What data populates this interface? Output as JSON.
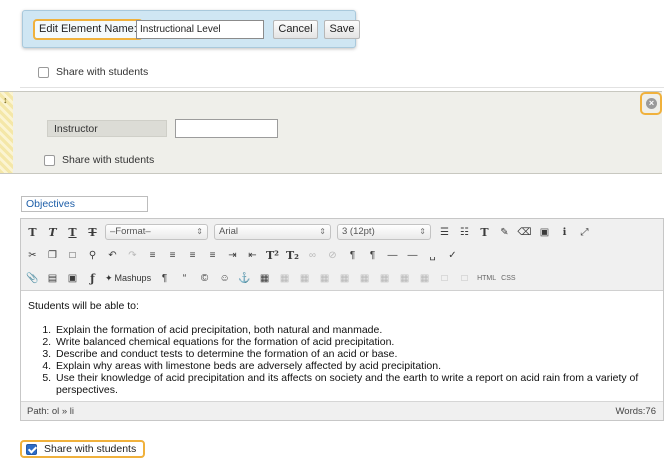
{
  "edit_popup": {
    "label": "Edit Element Name:",
    "input_value": "Instructional Level",
    "cancel_label": "Cancel",
    "save_label": "Save"
  },
  "share_top": {
    "label": "Share with students",
    "checked": false
  },
  "instructor_section": {
    "label": "Instructor",
    "input_value": "",
    "share_label": "Share with students",
    "share_checked": false
  },
  "objectives": {
    "field_value": "Objectives",
    "toolbar": {
      "format_select": "–Format–",
      "font_select": "Arial",
      "size_select": "3 (12pt)",
      "mashups_label": "Mashups",
      "html_label": "HTML",
      "css_label": "CSS"
    },
    "content": {
      "intro": "Students will be able to:",
      "items": [
        "Explain the formation of acid precipitation, both natural and manmade.",
        "Write balanced chemical equations for the formation of acid precipitation.",
        "Describe and conduct tests to determine the formation of an acid or base.",
        "Explain why areas with limestone beds are  adversely affected by acid precipitation.",
        "Use their knowledge of acid precipitation and its affects on society and the earth to write a report on acid rain from a variety of perspectives."
      ]
    },
    "path_label": "Path: ol » li",
    "words_label": "Words:76"
  },
  "share_bottom": {
    "label": "Share with students",
    "checked": true
  },
  "colors": {
    "highlight": "#f0b13c",
    "popup_bg": "#cfe6f3",
    "link_blue": "#1d5ea8"
  }
}
